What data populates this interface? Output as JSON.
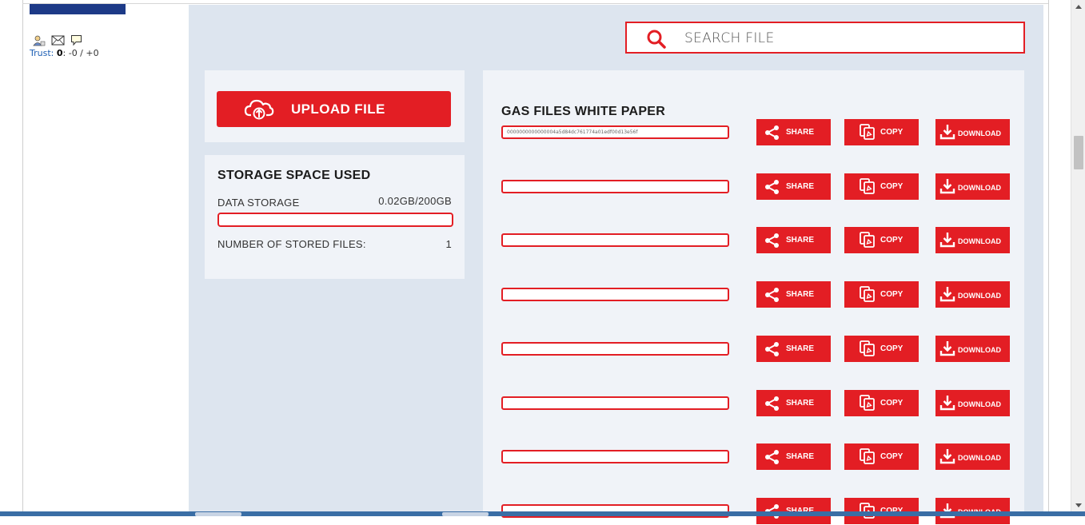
{
  "sidebar": {
    "trust_label": "Trust:",
    "trust_score": "0",
    "trust_rest": ": -0 / +0"
  },
  "search": {
    "placeholder": "SEARCH FILE"
  },
  "upload": {
    "label": "UPLOAD FILE"
  },
  "storage": {
    "title": "STORAGE SPACE USED",
    "data_label": "DATA STORAGE",
    "data_value": "0.02GB/200GB",
    "files_label": "NUMBER OF STORED FILES:",
    "files_value": "1"
  },
  "files": {
    "title": "GAS FILES WHITE PAPER",
    "rows": [
      {
        "hash": "0000000000000004a5d84dc761774a01edf00d13e56f"
      },
      {
        "hash": ""
      },
      {
        "hash": ""
      },
      {
        "hash": ""
      },
      {
        "hash": ""
      },
      {
        "hash": ""
      },
      {
        "hash": ""
      },
      {
        "hash": ""
      }
    ],
    "share_label": "SHARE",
    "copy_label": "COPY",
    "download_label": "DOWNLOAD"
  },
  "colors": {
    "accent": "#e31e24",
    "panel": "#dde5ef",
    "card": "#f0f3f8",
    "logo": "#1d3a87"
  },
  "icons": [
    "user-icon",
    "envelope-icon",
    "comment-icon",
    "search-icon",
    "cloud-upload-icon",
    "share-icon",
    "copy-icon",
    "download-icon"
  ]
}
